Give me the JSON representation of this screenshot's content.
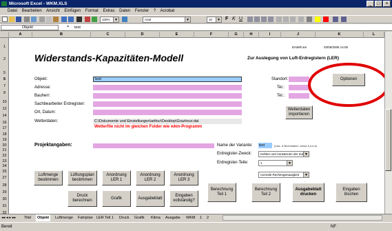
{
  "window": {
    "title": "Microsoft Excel - WKM.XLS",
    "min": "_",
    "max": "□",
    "close": "×"
  },
  "menu": [
    "Datei",
    "Bearbeiten",
    "Ansicht",
    "Einfügen",
    "Format",
    "Extras",
    "Daten",
    "Fenster",
    "?",
    "Acrobat"
  ],
  "toolbar": {
    "zoom": "100%",
    "font": "Arial",
    "size": "10"
  },
  "formula": {
    "name_box": "Objekt",
    "content": "test"
  },
  "columns": [
    "A",
    "B",
    "C",
    "D",
    "E",
    "F",
    "G",
    "H",
    "I",
    "J",
    "K",
    "L"
  ],
  "rows": [
    "1",
    "2",
    "5",
    "6",
    "7",
    "8",
    "10",
    "12",
    "14",
    "16",
    "17",
    "18",
    "19",
    "20",
    "21",
    "22",
    "23",
    "24",
    "25",
    "27",
    "28",
    "29",
    "30",
    "31",
    "32",
    "33"
  ],
  "sheet": {
    "created_label": "Erstellt am",
    "created_date": "03/06/2006 14:05",
    "title": "Widerstands-Kapazitäten-Modell",
    "subtitle": "Zur Auslegung von Luft-Erdregistern (LER)",
    "fields": {
      "objekt": "Objekt:",
      "objekt_value": "test",
      "adresse": "Adresse:",
      "bauherr": "Bauherr:",
      "sachbearbeiter": "Sachbearbeiter Erdregister:",
      "ort_datum": "Ort, Datum:",
      "wetterdaten": "Wetterdaten:",
      "wetter_path": "C:\\Dokumente und Einstellungen\\arthur\\Desktop\\Grazhour.dat",
      "warning": "Wetterfile nicht im gleichen Folder wie wkm-Programm"
    },
    "right_fields": {
      "standort": "Standort:",
      "tel1": "Tel.:",
      "tel2": "Tel.:"
    },
    "wetter_btn": "Wetterdaten importieren",
    "optionen_btn": "Optionen",
    "projekt": "Projektangaben:",
    "variant": {
      "name_label": "Name der Variante:",
      "name_value": "test",
      "name_hint": "(max. 8 Buchstaben, keine ä,ö,ü,ß)",
      "zweck_label": "Erdregister-Zweck:",
      "zweck_value": "Kühlen und Vorwärmen der Zuluft",
      "teile_label": "Erdregister-Teile:",
      "teile_value": "1",
      "genau_value": "normale Rechengenauigkeit"
    },
    "buttons": {
      "luftmenge": "Luftmenge bestimmen",
      "luftungsplan": "Lüftungsplan bestimmen",
      "anordnung1": "Anordnung LER 1",
      "anordnung2": "Anordnung LER 2",
      "anordnung3": "Anordnung LER 3",
      "druck": "Druck berechnen",
      "grafik": "Grafik",
      "ausgabeblatt": "Ausgabeblatt",
      "eingaben_vollst": "Eingaben vollständig?",
      "berechnung1": "Berechnung Teil 1",
      "berechnung2": "Berechnung Teil 2",
      "ausgabe_drucken": "Ausgabeblatt drucken",
      "eingaben_loeschen": "Eingaben löschen"
    }
  },
  "tabs": [
    "Titel",
    "Objekt",
    "Luftmenge",
    "Fahrplan",
    "LER Teil 1",
    "Druck",
    "Grafik",
    "Klima",
    "Ausgabe",
    "WKM",
    "1",
    "2"
  ],
  "status": {
    "left": "Bereit",
    "right": "NF"
  },
  "colors": {
    "pink": "#e3a6e3",
    "blue": "#99ccff",
    "red_circle": "#e00000",
    "warning": "#ff0000"
  }
}
